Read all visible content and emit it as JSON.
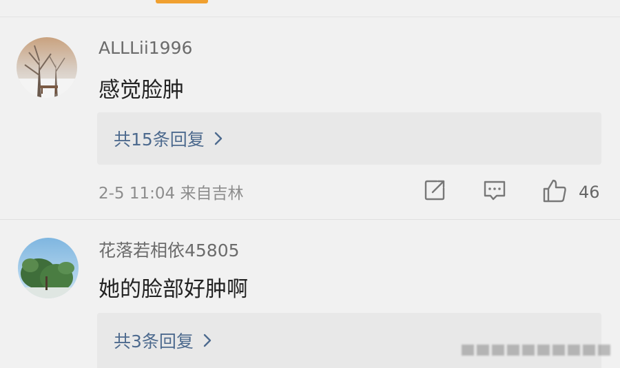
{
  "comments": [
    {
      "username": "ALLLii1996",
      "text": "感觉脸肿",
      "reply_label": "共15条回复",
      "time_location": "2-5 11:04  来自吉林",
      "like_count": "46",
      "icons": [
        "avatar-winter-tree",
        "share-icon",
        "comment-icon",
        "like-icon",
        "chevron-right-icon"
      ]
    },
    {
      "username": "花落若相依45805",
      "text": "她的脸部好肿啊",
      "reply_label": "共3条回复",
      "icons": [
        "avatar-tree-sky",
        "chevron-right-icon"
      ]
    }
  ],
  "colors": {
    "background": "#f1f1f1",
    "reply_box": "#e8e8e8",
    "link_blue": "#4d6a8e",
    "accent_orange": "#f0a030"
  }
}
